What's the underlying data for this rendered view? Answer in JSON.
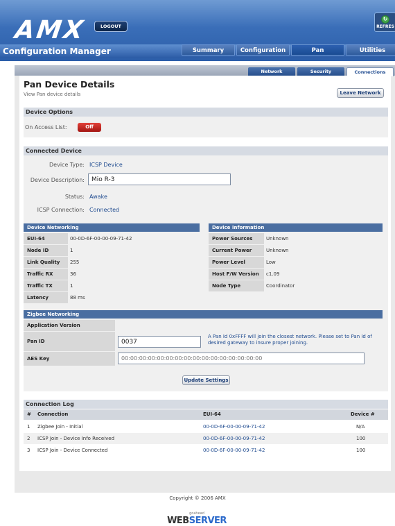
{
  "brand": {
    "logo": "AMX",
    "logout": "LOGOUT",
    "refresh": "REFRES"
  },
  "app_title": "Configuration Manager",
  "main_tabs": [
    "Summary",
    "Configuration",
    "Pan",
    "Utilities"
  ],
  "sub_tabs": [
    "Network",
    "Security",
    "Connections"
  ],
  "page": {
    "title": "Pan Device Details",
    "subtitle": "View Pan device details",
    "leave_network": "Leave Network"
  },
  "device_options": {
    "header": "Device Options",
    "on_access_list_label": "On Access List:",
    "on_access_list_value": "Off"
  },
  "connected_device": {
    "header": "Connected Device",
    "device_type_label": "Device Type:",
    "device_type": "ICSP Device",
    "device_description_label": "Device Description:",
    "device_description": "Mio R-3",
    "status_label": "Status:",
    "status": "Awake",
    "icsp_connection_label": "ICSP Connection:",
    "icsp_connection": "Connected"
  },
  "device_networking": {
    "header": "Device Networking",
    "rows": [
      {
        "k": "EUI-64",
        "v": "00-0D-6F-00-00-09-71-42"
      },
      {
        "k": "Node ID",
        "v": "1"
      },
      {
        "k": "Link Quality",
        "v": "255"
      },
      {
        "k": "Traffic RX",
        "v": "36"
      },
      {
        "k": "Traffic TX",
        "v": "1"
      },
      {
        "k": "Latency",
        "v": "88 ms"
      }
    ]
  },
  "device_information": {
    "header": "Device Information",
    "rows": [
      {
        "k": "Power Sources",
        "v": "Unknown"
      },
      {
        "k": "Current Power",
        "v": "Unknown"
      },
      {
        "k": "Power Level",
        "v": "Low"
      },
      {
        "k": "Host F/W Version",
        "v": "c1.09"
      },
      {
        "k": "Node Type",
        "v": "Coordinator"
      }
    ]
  },
  "zigbee": {
    "header": "Zigbee Networking",
    "app_version_label": "Application Version",
    "pan_id_label": "Pan ID",
    "pan_id_value": "0037",
    "pan_note": "A Pan Id 0xFFFF will join the closest network. Please set to Pan Id of desired gateway to insure proper joining.",
    "aes_label": "AES Key",
    "aes_placeholder": "00:00:00:00:00:00:00:00:00:00:00:00:00:00:00:00",
    "update_button": "Update Settings"
  },
  "log": {
    "header": "Connection Log",
    "columns": [
      "#",
      "Connection",
      "EUI-64",
      "Device #"
    ],
    "rows": [
      {
        "n": "1",
        "conn": "Zigbee Join - Initial",
        "eui": "00-0D-6F-00-00-09-71-42",
        "dev": "N/A"
      },
      {
        "n": "2",
        "conn": "ICSP Join - Device Info Received",
        "eui": "00-0D-6F-00-00-09-71-42",
        "dev": "100"
      },
      {
        "n": "3",
        "conn": "ICSP Join - Device Connected",
        "eui": "00-0D-6F-00-00-09-71-42",
        "dev": "100"
      }
    ]
  },
  "footer": {
    "copyright": "Copyright © 2006 AMX",
    "goahead": "goahead",
    "web": "WEB",
    "server": "SERVER"
  }
}
